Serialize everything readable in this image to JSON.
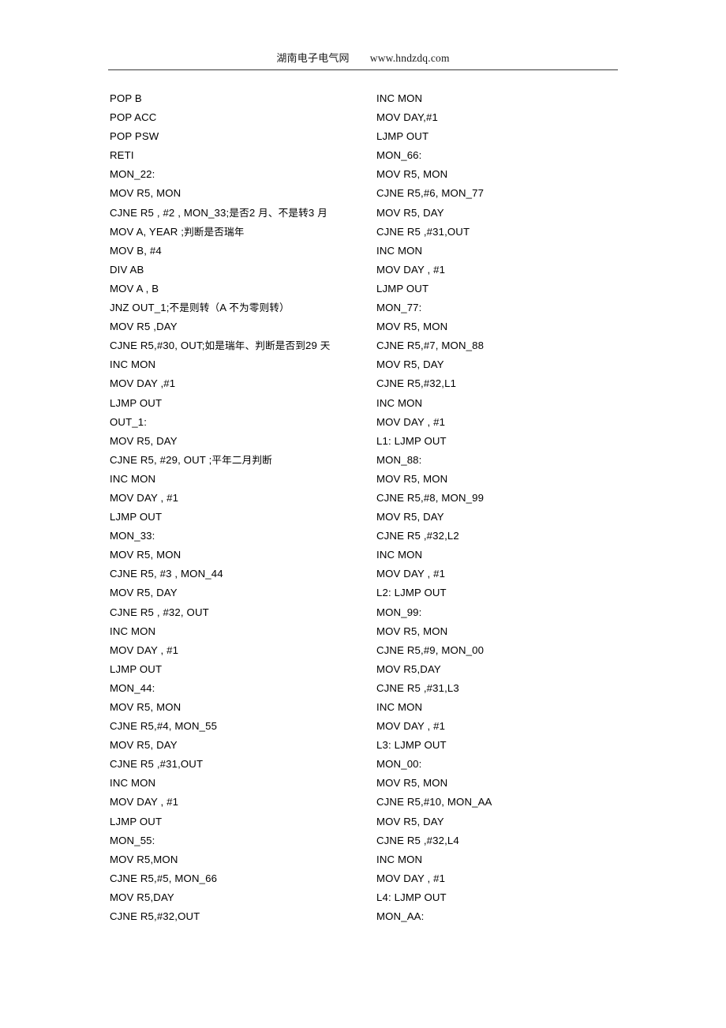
{
  "document": {
    "header": {
      "site_name": "湖南电子电气网",
      "url": "www.hndzdq.com"
    }
  },
  "code": {
    "left_column": [
      "POP B",
      "POP ACC",
      "POP PSW",
      "RETI",
      "MON_22:",
      "MOV R5, MON",
      "CJNE R5 , #2 , MON_33;是否2 月、不是转3 月",
      "MOV A, YEAR ;判断是否瑞年",
      "MOV B, #4",
      "DIV AB",
      "MOV A , B",
      "JNZ OUT_1;不是则转（A 不为零则转）",
      "MOV R5 ,DAY",
      "CJNE R5,#30, OUT;如是瑞年、判断是否到29 天",
      "INC MON",
      "MOV DAY ,#1",
      "LJMP OUT",
      "OUT_1:",
      "MOV R5, DAY",
      "CJNE R5, #29, OUT ;平年二月判断",
      "INC MON",
      "MOV DAY , #1",
      "LJMP OUT",
      "MON_33:",
      "MOV R5, MON",
      "CJNE R5, #3 , MON_44",
      "MOV R5, DAY",
      "CJNE R5 , #32, OUT",
      "INC MON",
      "MOV DAY , #1",
      "LJMP OUT",
      "MON_44:",
      "MOV R5, MON",
      "CJNE R5,#4, MON_55",
      "MOV R5, DAY",
      "CJNE R5 ,#31,OUT",
      "INC MON",
      "MOV DAY , #1",
      "LJMP OUT",
      "MON_55:",
      "MOV R5,MON",
      "CJNE R5,#5, MON_66",
      "MOV R5,DAY",
      "CJNE R5,#32,OUT"
    ],
    "right_column": [
      "INC MON",
      "MOV DAY,#1",
      "LJMP OUT",
      "MON_66:",
      "MOV R5, MON",
      "CJNE R5,#6, MON_77",
      "MOV R5, DAY",
      "CJNE R5 ,#31,OUT",
      "INC MON",
      "MOV DAY , #1",
      "LJMP OUT",
      "MON_77:",
      "MOV R5, MON",
      "CJNE R5,#7, MON_88",
      "MOV R5, DAY",
      "CJNE R5,#32,L1",
      "INC MON",
      "MOV DAY , #1",
      "L1: LJMP OUT",
      "MON_88:",
      "MOV R5, MON",
      "CJNE R5,#8, MON_99",
      "MOV R5, DAY",
      "CJNE R5 ,#32,L2",
      "INC MON",
      "MOV DAY , #1",
      "L2: LJMP OUT",
      "MON_99:",
      "MOV R5, MON",
      "CJNE R5,#9, MON_00",
      "MOV R5,DAY",
      "CJNE R5 ,#31,L3",
      "INC MON",
      "MOV DAY , #1",
      "L3: LJMP OUT",
      "MON_00:",
      "MOV R5, MON",
      "CJNE R5,#10, MON_AA",
      "MOV R5, DAY",
      "CJNE R5 ,#32,L4",
      "INC MON",
      "MOV DAY , #1",
      "L4: LJMP OUT",
      "MON_AA:"
    ]
  }
}
